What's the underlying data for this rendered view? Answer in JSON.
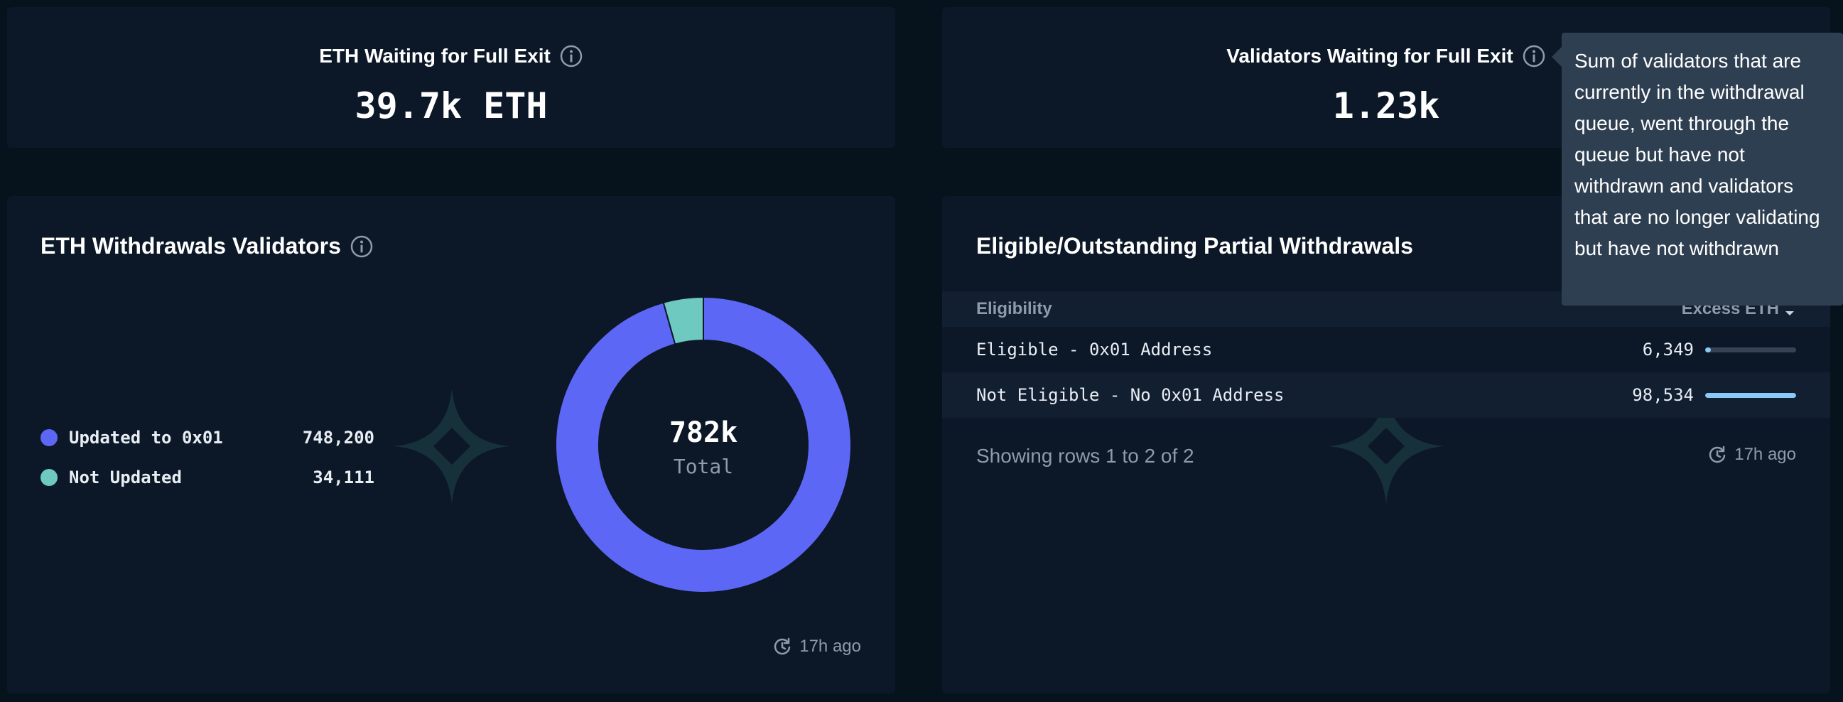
{
  "cards": {
    "eth_waiting": {
      "title": "ETH Waiting for Full Exit",
      "value": "39.7k ETH"
    },
    "validators_waiting": {
      "title": "Validators Waiting for Full Exit",
      "value": "1.23k"
    }
  },
  "tooltip": {
    "text": "Sum of validators that are currently in the withdrawal queue, went through the queue but have not withdrawn and validators that are no longer validating but have not withdrawn"
  },
  "withdrawals_validators": {
    "title": "ETH Withdrawals Validators",
    "legend": [
      {
        "label": "Updated to 0x01",
        "value": "748,200",
        "color": "#5d67f5"
      },
      {
        "label": "Not Updated",
        "value": "34,111",
        "color": "#6ec9c0"
      }
    ],
    "center_value": "782k",
    "center_label": "Total",
    "updated": "17h ago"
  },
  "chart_data": {
    "type": "pie",
    "variant": "donut",
    "categories": [
      "Updated to 0x01",
      "Not Updated"
    ],
    "values": [
      748200,
      34111
    ],
    "colors": [
      "#5d67f5",
      "#6ec9c0"
    ],
    "center_text": "782k",
    "center_subtext": "Total"
  },
  "partial_withdrawals": {
    "title": "Eligible/Outstanding Partial Withdrawals",
    "columns": [
      "Eligibility",
      "Excess ETH"
    ],
    "rows": [
      {
        "label": "Eligible - 0x01 Address",
        "value": "6,349",
        "fraction": 0.064
      },
      {
        "label": "Not Eligible - No 0x01 Address",
        "value": "98,534",
        "fraction": 1.0
      }
    ],
    "showing": "Showing rows 1 to 2 of 2",
    "updated": "17h ago"
  },
  "icons": {
    "info": "info-icon",
    "refresh": "refresh-clock-icon",
    "sort": "sort-desc-icon",
    "watermark": "sparkle-logo-icon"
  },
  "colors": {
    "background": "#07131c",
    "card": "#0c1827",
    "accent_blue": "#5d67f5",
    "accent_teal": "#6ec9c0",
    "bar": "#8cc8f5",
    "tooltip": "#2f3f52"
  }
}
